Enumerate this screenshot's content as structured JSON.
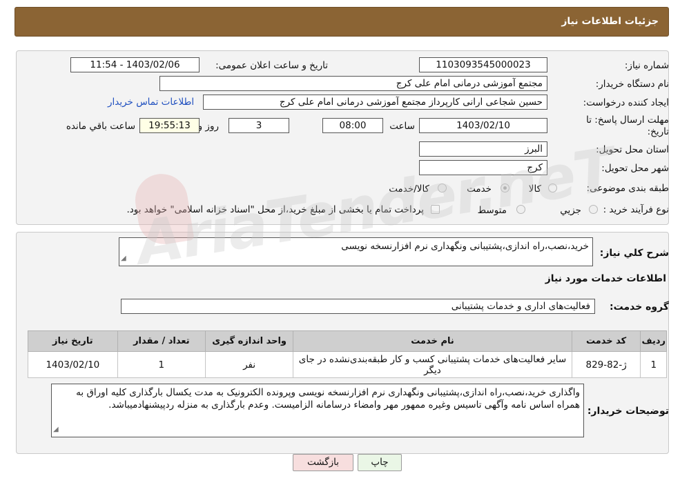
{
  "header": {
    "title": "جزئیات اطلاعات نیاز"
  },
  "form": {
    "need_number_label": "شماره نیاز:",
    "need_number": "1103093545000023",
    "announce_label": "تاریخ و ساعت اعلان عمومی:",
    "announce_value": "1403/02/06 - 11:54",
    "buyer_org_label": "نام دستگاه خریدار:",
    "buyer_org": "مجتمع آموزشی درمانی امام علی کرج",
    "requester_label": "ایجاد کننده درخواست:",
    "requester": "حسین شجاعی ارانی کارپرداز مجتمع آموزشی درمانی امام علی کرج",
    "contact_link": "اطلاعات تماس خریدار",
    "deadline_label_1": "مهلت ارسال پاسخ: تا",
    "deadline_label_2": "تاریخ:",
    "deadline_date": "1403/02/10",
    "time_label": "ساعت",
    "deadline_time": "08:00",
    "days_value": "3",
    "days_label": "روز و",
    "countdown": "19:55:13",
    "remaining_label": "ساعت باقي مانده",
    "province_label": "استان محل تحویل:",
    "province": "البرز",
    "city_label": "شهر محل تحویل:",
    "city": "کرج",
    "category_label": "طبقه بندی موضوعی:",
    "category_options": [
      "کالا",
      "خدمت",
      "کالا/خدمت"
    ],
    "category_selected": "خدمت",
    "process_label": "نوع فرآیند خرید :",
    "process_options": [
      "جزیي",
      "متوسط"
    ],
    "payment_note": "پرداخت تمام یا بخشی از مبلغ خرید،از محل \"اسناد خزانه اسلامی\" خواهد بود."
  },
  "summary": {
    "label": "شرح کلي نیاز:",
    "text": "خرید،نصب،راه اندازی،پشتیبانی ونگهداری نرم افزارنسخه نویسی"
  },
  "services": {
    "title": "اطلاعات خدمات مورد نیاز",
    "group_label": "گروه خدمت:",
    "group_value": "فعالیت‌های اداری و خدمات پشتیبانی",
    "columns": [
      "ردیف",
      "کد خدمت",
      "نام خدمت",
      "واحد اندازه گیری",
      "تعداد / مقدار",
      "تاریخ نیاز"
    ],
    "rows": [
      {
        "row": "1",
        "code": "ژ-82-829",
        "name": "سایر فعالیت‌های خدمات پشتیبانی کسب و کار طبقه‌بندی‌نشده در جای دیگر",
        "unit": "نفر",
        "qty": "1",
        "date": "1403/02/10"
      }
    ]
  },
  "buyer_notes": {
    "label": "توضیحات خریدار:",
    "text": "واگذاری خرید،نصب،راه اندازی،پشتیبانی ونگهداری نرم افزارنسخه نویسی وپرونده الکترونیک به مدت یکسال بارگذاری کلیه اوراق به همراه اساس نامه وآگهی تاسیس وغیره ممهور مهر وامضاء درسامانه الزامیست. وعدم بارگذاری به منزله ردپیشنهادمیباشد."
  },
  "buttons": {
    "print": "چاپ",
    "back": "بازگشت"
  },
  "watermark": {
    "text": "AriaTender.neT"
  },
  "colors": {
    "header": "#8b6434",
    "link": "#1f4fbf",
    "back_button": "#f7dede",
    "print_button": "#eaf6e6"
  }
}
